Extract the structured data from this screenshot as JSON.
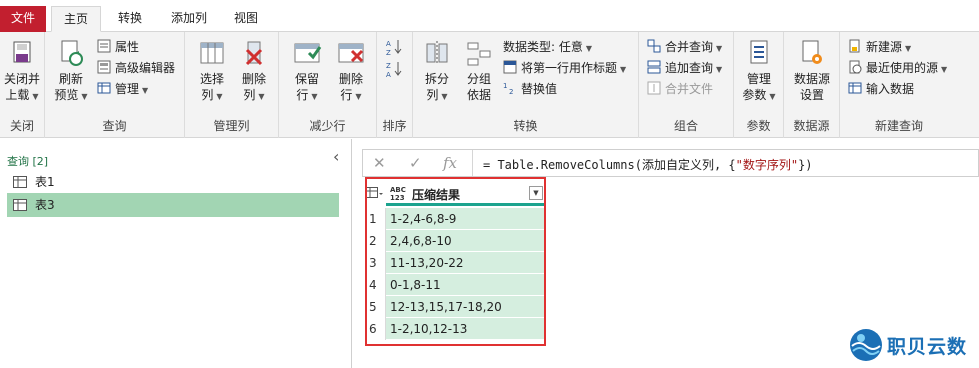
{
  "tabs": [
    {
      "label": "文件"
    },
    {
      "label": "主页"
    },
    {
      "label": "转换"
    },
    {
      "label": "添加列"
    },
    {
      "label": "视图"
    }
  ],
  "ribbon": {
    "close": {
      "btn_line1": "关闭并",
      "btn_line2": "上载",
      "group": "关闭"
    },
    "query": {
      "refresh_line1": "刷新",
      "refresh_line2": "预览",
      "properties": "属性",
      "advanced_editor": "高级编辑器",
      "manage": "管理",
      "group": "查询"
    },
    "manage_columns": {
      "choose_line1": "选择",
      "choose_line2": "列",
      "remove_line1": "删除",
      "remove_line2": "列",
      "group": "管理列"
    },
    "reduce_rows": {
      "keep_line1": "保留",
      "keep_line2": "行",
      "remove_line1": "删除",
      "remove_line2": "行",
      "group": "减少行"
    },
    "sort": {
      "group": "排序"
    },
    "transform": {
      "split_line1": "拆分",
      "split_line2": "列",
      "group_line1": "分组",
      "group_line2": "依据",
      "data_type": "数据类型: 任意",
      "first_row_header": "将第一行用作标题",
      "replace_values": "替换值",
      "group": "转换"
    },
    "combine": {
      "merge_queries": "合并查询",
      "append_queries": "追加查询",
      "combine_files": "合并文件",
      "group": "组合"
    },
    "params": {
      "manage_line1": "管理",
      "manage_line2": "参数",
      "group": "参数"
    },
    "datasource": {
      "settings_line1": "数据源",
      "settings_line2": "设置",
      "group": "数据源"
    },
    "new_query": {
      "new_source": "新建源",
      "recent_sources": "最近使用的源",
      "enter_data": "输入数据",
      "group": "新建查询"
    }
  },
  "queries_pane": {
    "header": "查询 [2]",
    "items": [
      {
        "label": "表1",
        "selected": false
      },
      {
        "label": "表3",
        "selected": true
      }
    ]
  },
  "formula_bar": {
    "cancel_icon": "✕",
    "confirm_icon": "✓",
    "fx_icon": "fx",
    "formula_prefix": "= Table.RemoveColumns(添加自定义列, {",
    "formula_string": "\"数字序列\"",
    "formula_suffix": "})"
  },
  "grid": {
    "type_badge_line1": "ABC",
    "type_badge_line2": "123",
    "column_header": "压缩结果",
    "rows": [
      {
        "n": "1",
        "value": "1-2,4-6,8-9"
      },
      {
        "n": "2",
        "value": "2,4,6,8-10"
      },
      {
        "n": "3",
        "value": "11-13,20-22"
      },
      {
        "n": "4",
        "value": "0-1,8-11"
      },
      {
        "n": "5",
        "value": "12-13,15,17-18,20"
      },
      {
        "n": "6",
        "value": "1-2,10,12-13"
      }
    ]
  },
  "watermark": {
    "text": "职贝云数"
  },
  "colors": {
    "file_tab": "#c21f2f",
    "accent_green": "#217346",
    "selected_row": "#a2d5b3",
    "cell_bg": "#d5eedf",
    "highlight_box": "#e03131"
  }
}
